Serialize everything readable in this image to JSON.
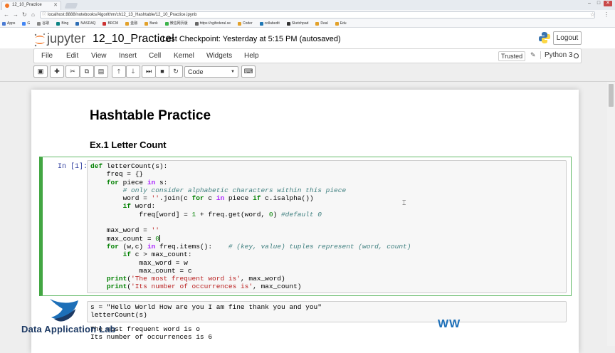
{
  "browser": {
    "tab_title": "12_10_Practice",
    "url": "localhost:8888/notebooks/Algorithm/ch12_13_Hashtable/12_10_Practice.ipynb",
    "bookmarks": [
      {
        "label": "Apps",
        "color": "#4a7bd4"
      },
      {
        "label": "G",
        "color": "#4285f4"
      },
      {
        "label": "谷歌",
        "color": "#888"
      },
      {
        "label": "Bing",
        "color": "#0c8484"
      },
      {
        "label": "NASDAQ",
        "color": "#2d6db5"
      },
      {
        "label": "BRCM",
        "color": "#c33"
      },
      {
        "label": "金融",
        "color": "#e2a12a"
      },
      {
        "label": "Bank",
        "color": "#e2a12a"
      },
      {
        "label": "微信网页版",
        "color": "#3bb34a"
      },
      {
        "label": "https://cgifederal.se",
        "color": "#666"
      },
      {
        "label": "Coder",
        "color": "#e2a12a"
      },
      {
        "label": "collabedit",
        "color": "#1f77b4"
      },
      {
        "label": "Sketchpad",
        "color": "#333"
      },
      {
        "label": "Deal",
        "color": "#e2a12a"
      },
      {
        "label": "Edu",
        "color": "#e2a12a"
      }
    ]
  },
  "jupyter": {
    "logo_text": "jupyter",
    "notebook_title": "12_10_Practicel",
    "checkpoint": "Last Checkpoint: Yesterday at 5:15 PM (autosaved)",
    "logout_label": "Logout",
    "menu": [
      "File",
      "Edit",
      "View",
      "Insert",
      "Cell",
      "Kernel",
      "Widgets",
      "Help"
    ],
    "trusted_label": "Trusted",
    "kernel_name": "Python 3",
    "cell_type": "Code"
  },
  "content": {
    "heading1": "Hashtable Practice",
    "heading2": "Ex.1 Letter Count",
    "cell1_prompt": "In [1]:",
    "cell2_code": "s = \"Hello World How are you I am fine thank you and you\"\nletterCount(s)",
    "cell2_output": "The most frequent word is o\nIts number of occurrences is 6"
  },
  "watermark": {
    "text": "Data Application Lab",
    "right_text": "WW"
  }
}
